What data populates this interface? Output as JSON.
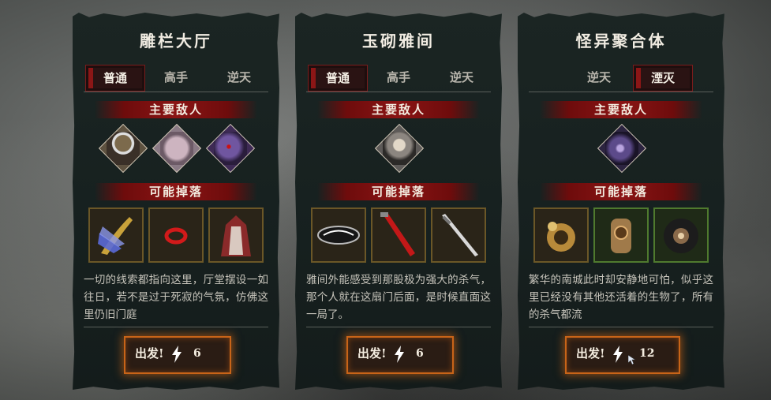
{
  "cards": [
    {
      "title": "雕栏大厅",
      "tabs": [
        "普通",
        "高手",
        "逆天"
      ],
      "active_tab": "普通",
      "enemies_label": "主要敌人",
      "drops_label": "可能掉落",
      "enemies": [
        "straw-hat-enemy-portrait",
        "pale-pig-enemy-portrait",
        "purple-masked-enemy-portrait"
      ],
      "drops": [
        "feather-wing-blade-item",
        "red-ring-item",
        "red-hood-cloak-item"
      ],
      "description": "一切的线索都指向这里，厅堂摆设一如往日，若不是过于死寂的气氛，仿佛这里仍旧门庭",
      "start_label": "出发!",
      "cost": "6"
    },
    {
      "title": "玉砌雅间",
      "tabs": [
        "普通",
        "高手",
        "逆天"
      ],
      "active_tab": "普通",
      "enemies_label": "主要敌人",
      "drops_label": "可能掉落",
      "enemies": [
        "long-haired-swordsman-portrait"
      ],
      "drops": [
        "black-armor-piece-item",
        "red-blade-item",
        "silver-sword-item"
      ],
      "description": "雅间外能感受到那股极为强大的杀气，那个人就在这扇门后面，是时候直面这一局了。",
      "start_label": "出发!",
      "cost": "6"
    },
    {
      "title": "怪异聚合体",
      "tabs": [
        "逆天",
        "湮灭"
      ],
      "active_tab": "湮灭",
      "enemies_label": "主要敌人",
      "drops_label": "可能掉落",
      "enemies": [
        "purple-aberration-portrait"
      ],
      "drops": [
        "golden-gauntlet-item",
        "bronze-mechanism-item",
        "dark-coil-item"
      ],
      "description": "繁华的南城此时却安静地可怕，似乎这里已经没有其他还活着的生物了，所有的杀气都流",
      "start_label": "出发!",
      "cost": "12"
    }
  ],
  "colors": {
    "accent_red": "#8a1414",
    "button_glow": "#c86418",
    "frame_gold": "#6b5727",
    "frame_green": "#4f7a2e"
  }
}
